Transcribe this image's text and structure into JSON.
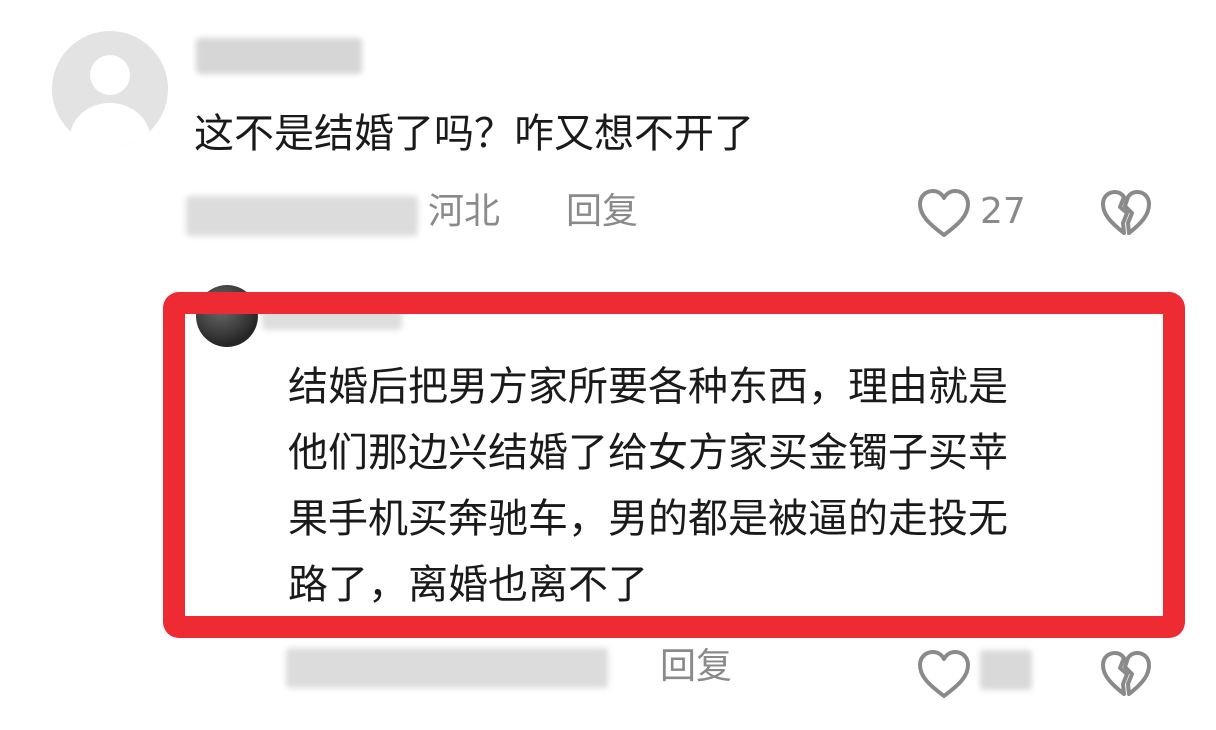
{
  "comment": {
    "text": "这不是结婚了吗？咋又想不开了",
    "location": "河北",
    "reply_label": "回复",
    "like_count": "27",
    "icons": {
      "like": "heart-outline-icon",
      "dislike": "broken-heart-icon"
    }
  },
  "reply_comment": {
    "text_lines": [
      "结婚后把男方家所要各种东西，理由就是",
      "他们那边兴结婚了给女方家买金镯子买苹",
      "果手机买奔驰车，男的都是被逼的走投无",
      "路了，离婚也离不了"
    ],
    "reply_label": "回复",
    "highlight_color": "#ee2b33",
    "icons": {
      "like": "heart-outline-icon",
      "dislike": "broken-heart-icon"
    }
  }
}
